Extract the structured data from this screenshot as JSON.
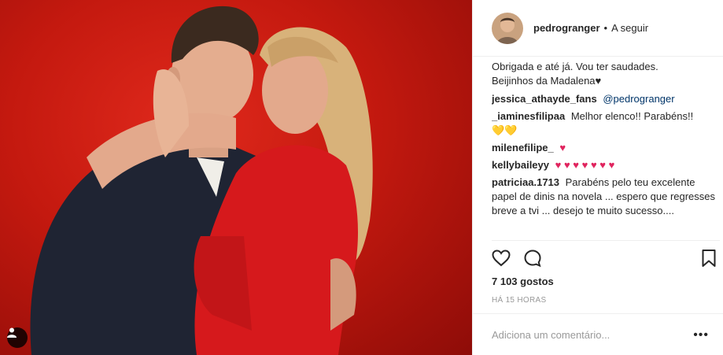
{
  "post": {
    "username": "pedrogranger",
    "follow_dot": "•",
    "follow_label": "A seguir",
    "caption_line1": "Obrigada e até já. Vou ter saudades.",
    "caption_line2": "Beijinhos da Madalena♥",
    "comments": [
      {
        "user": "jessica_athayde_fans",
        "text": "@pedrogranger"
      },
      {
        "user": "_iaminesfilipaa",
        "text": "Melhor elenco!! Parabéns!!",
        "extra": "💛💛"
      },
      {
        "user": "milenefilipe_",
        "text": "♥"
      },
      {
        "user": "kellybaileyy",
        "text": "♥ ♥ ♥ ♥ ♥ ♥ ♥"
      },
      {
        "user": "patriciaa.1713",
        "text": "Parabéns pelo teu excelente papel de dinis na novela ... espero que regresses breve a tvi ... desejo te muito sucesso...."
      }
    ],
    "likes": "7 103 gostos",
    "time": "HÁ 15 HORAS",
    "add_comment_placeholder": "Adiciona um comentário...",
    "more_label": "•••"
  },
  "icons": {
    "like": "heart-outline-icon",
    "comment": "comment-bubble-icon",
    "save": "bookmark-icon",
    "tag": "user-tag-icon"
  },
  "colors": {
    "photo_bg": "#c4190f",
    "mention": "#003569",
    "heart": "#e0245e"
  }
}
